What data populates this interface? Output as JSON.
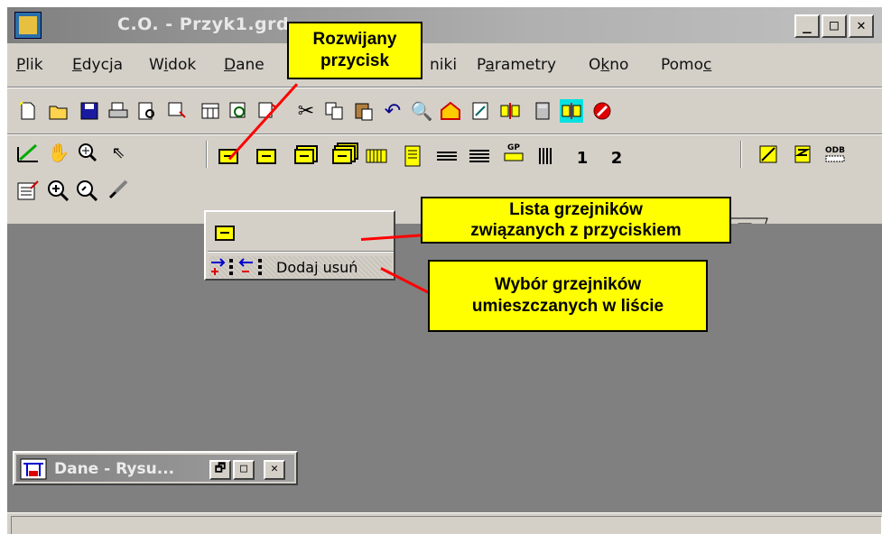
{
  "window": {
    "title": "C.O. - Przyk1.grd",
    "minimize": "_",
    "maximize": "□",
    "close": "✕"
  },
  "menu": {
    "items": [
      {
        "pre": "",
        "u": "P",
        "post": "lik"
      },
      {
        "pre": "",
        "u": "E",
        "post": "dycja"
      },
      {
        "pre": "W",
        "u": "i",
        "post": "dok"
      },
      {
        "pre": "",
        "u": "D",
        "post": "ane"
      },
      {
        "pre": "",
        "u": "",
        "post": "niki"
      },
      {
        "pre": "P",
        "u": "a",
        "post": "rametry"
      },
      {
        "pre": "O",
        "u": "k",
        "post": "no"
      },
      {
        "pre": "Pomo",
        "u": "c",
        "post": ""
      }
    ]
  },
  "toolbar2": {
    "label_1": "1",
    "label_2": "2",
    "gp_label": "GP",
    "odb_label": "ODB"
  },
  "dropdown": {
    "add_remove_label": "Dodaj usuń"
  },
  "callouts": {
    "dropdown_button": [
      "Rozwijany",
      "przycisk"
    ],
    "list": [
      "Lista  grzejników",
      "związanych  z  przyciskiem"
    ],
    "choose": [
      "Wybór  grzejników",
      "umieszczanych  w  liście"
    ]
  },
  "mdi": {
    "title": "Dane - Rysu...",
    "restore": "🗗",
    "maximize": "□",
    "close": "✕"
  },
  "colors": {
    "callout_bg": "#ffff00",
    "pointer_line": "#ff0000",
    "workspace": "#808080",
    "chrome": "#d4d0c8"
  }
}
